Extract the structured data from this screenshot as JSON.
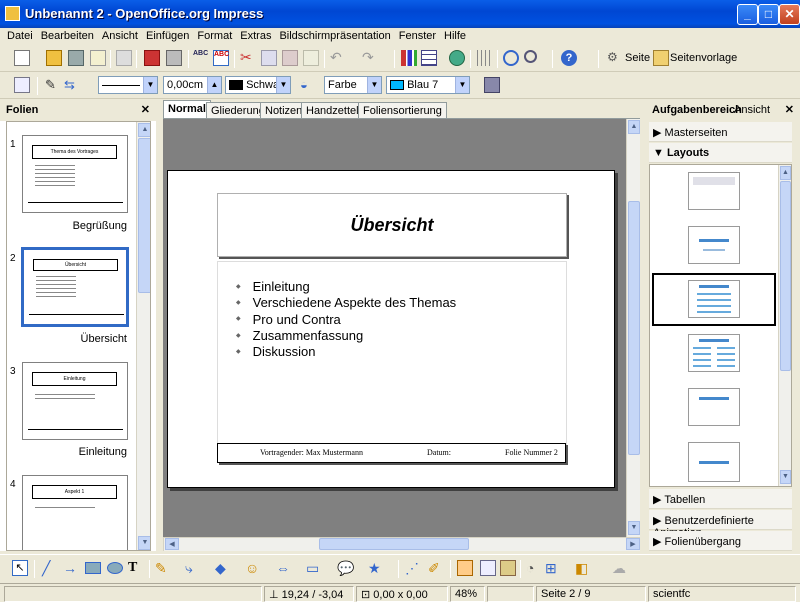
{
  "window": {
    "title": "Unbenannt 2 - OpenOffice.org Impress",
    "minimize": "_",
    "maximize": "□",
    "close": "✕"
  },
  "menu": [
    "Datei",
    "Bearbeiten",
    "Ansicht",
    "Einfügen",
    "Format",
    "Extras",
    "Bildschirmpräsentation",
    "Fenster",
    "Hilfe"
  ],
  "toolbar1": {
    "page_label": "Seite",
    "page_layout_label": "Seitenvorlage"
  },
  "toolbar2": {
    "line_width": "0,00cm",
    "line_color": "Schwarz",
    "area_style": "Farbe",
    "area_color": "Blau 7"
  },
  "slides_panel": {
    "title": "Folien",
    "close": "✕",
    "slides": [
      {
        "num": "1",
        "label": "Begrüßung",
        "heading": "Thema des Vortrages"
      },
      {
        "num": "2",
        "label": "Übersicht",
        "heading": "Übersicht"
      },
      {
        "num": "3",
        "label": "Einleitung",
        "heading": "Einleitung"
      },
      {
        "num": "4",
        "label": "",
        "heading": "Aspekt 1"
      }
    ]
  },
  "view_tabs": [
    "Normal",
    "Gliederung",
    "Notizen",
    "Handzettel",
    "Foliensortierung"
  ],
  "slide": {
    "title": "Übersicht",
    "bullets": [
      "Einleitung",
      "Verschiedene Aspekte des Themas",
      "Pro und Contra",
      "Zusammenfassung",
      "Diskussion"
    ],
    "footer_presenter": "Vortragender: Max Mustermann",
    "footer_date": "Datum:",
    "footer_slide": "Folie Nummer 2"
  },
  "task_pane": {
    "title": "Aufgabenbereich",
    "view_label": "Ansicht",
    "close": "✕",
    "sections": {
      "master": "Masterseiten",
      "layouts": "Layouts",
      "tables": "Tabellen",
      "animation": "Benutzerdefinierte Animation",
      "transition": "Folienübergang"
    }
  },
  "status": {
    "position": "19,24 / -3,04",
    "size": "0,00 x 0,00",
    "zoom": "48%",
    "page": "Seite 2 / 9",
    "style": "scientfc"
  },
  "colors": {
    "accent": "#316ac5",
    "line_color": "#000000",
    "area_color": "#00b8ff",
    "titlebar": "#0054e3"
  }
}
